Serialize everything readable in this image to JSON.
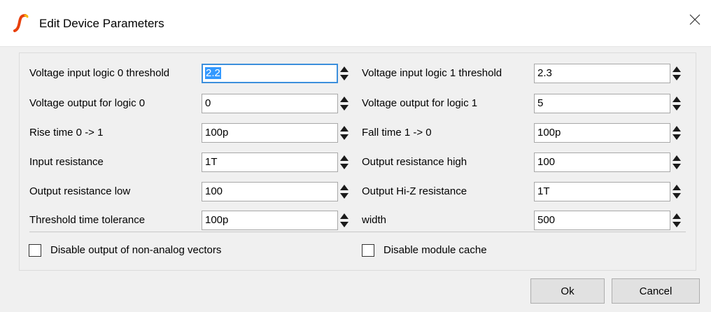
{
  "window": {
    "title": "Edit Device Parameters"
  },
  "left_params": [
    {
      "label": "Voltage input logic 0 threshold",
      "value": "2.2"
    },
    {
      "label": "Voltage output for logic 0",
      "value": "0"
    },
    {
      "label": "Rise time 0 -> 1",
      "value": "100p"
    },
    {
      "label": "Input resistance",
      "value": "1T"
    },
    {
      "label": "Output resistance low",
      "value": "100"
    },
    {
      "label": "Threshold time tolerance",
      "value": "100p"
    }
  ],
  "right_params": [
    {
      "label": "Voltage input logic 1 threshold",
      "value": "2.3"
    },
    {
      "label": "Voltage output for logic 1",
      "value": "5"
    },
    {
      "label": "Fall time 1 -> 0",
      "value": "100p"
    },
    {
      "label": "Output resistance high",
      "value": "100"
    },
    {
      "label": "Output Hi-Z resistance",
      "value": "1T"
    },
    {
      "label": "width",
      "value": "500"
    }
  ],
  "options": {
    "disable_non_analog": {
      "label": "Disable output of non-analog vectors",
      "checked": false
    },
    "disable_module_cache": {
      "label": "Disable module cache",
      "checked": false
    }
  },
  "buttons": {
    "ok": "Ok",
    "cancel": "Cancel"
  },
  "icons": {
    "app": "ltspice-logo-icon",
    "close": "close-icon",
    "spinner": "spin-arrows-icon"
  },
  "colors": {
    "focus": "#3c8fdc",
    "selection": "#3399ff",
    "logo": "#e8400c"
  }
}
